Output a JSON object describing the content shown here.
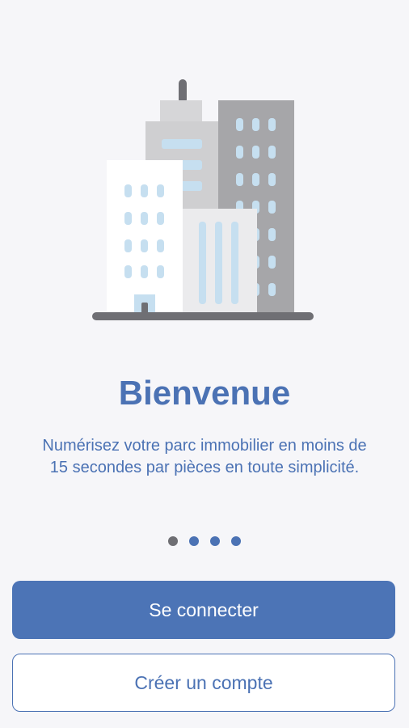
{
  "onboarding": {
    "illustration_icon": "city-buildings-icon",
    "title": "Bienvenue",
    "subtitle": "Numérisez votre parc immobilier en moins de 15 secondes par pièces en toute simplicité.",
    "pager": {
      "total_pages": 4,
      "current_page": 1
    },
    "login_button": "Se connecter",
    "signup_button": "Créer un compte"
  },
  "colors": {
    "accent": "#4c74b6",
    "background": "#f6f6f9",
    "inactive_dot": "#6e6e73"
  }
}
